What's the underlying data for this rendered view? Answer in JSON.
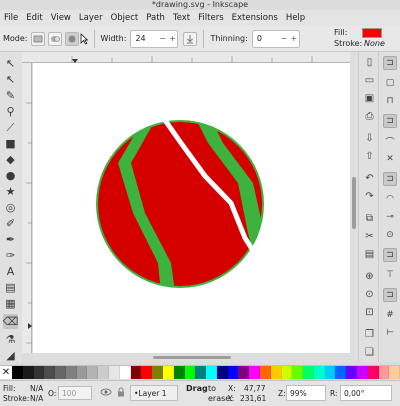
{
  "window": {
    "title": "*drawing.svg - Inkscape"
  },
  "menu": [
    "File",
    "Edit",
    "View",
    "Layer",
    "Object",
    "Path",
    "Text",
    "Filters",
    "Extensions",
    "Help"
  ],
  "toolctrl": {
    "mode_label": "Mode:",
    "width_label": "Width:",
    "width_value": "24",
    "thinning_label": "Thinning:",
    "thinning_value": "0",
    "minus": "−",
    "plus": "+"
  },
  "style": {
    "fill_label": "Fill:",
    "fill_color": "#ff0000",
    "stroke_label": "Stroke:",
    "stroke_value": "None"
  },
  "drawing": {
    "fill": "#d40000",
    "stroke": "#3db33d"
  },
  "palette": [
    "#000000",
    "#1a1a1a",
    "#333333",
    "#4d4d4d",
    "#666666",
    "#808080",
    "#999999",
    "#b3b3b3",
    "#cccccc",
    "#e6e6e6",
    "#ffffff",
    "#800000",
    "#ff0000",
    "#808000",
    "#ffff00",
    "#008000",
    "#00ff00",
    "#008080",
    "#00ffff",
    "#000080",
    "#0000ff",
    "#800080",
    "#ff00ff",
    "#ff6600",
    "#ffcc00",
    "#ccff00",
    "#66ff00",
    "#00ff66",
    "#00ffcc",
    "#00ccff",
    "#0066ff",
    "#6600ff",
    "#cc00ff",
    "#ff0066",
    "#ff9999",
    "#ffcc99"
  ],
  "status": {
    "fill_label": "Fill:",
    "fill_value": "N/A",
    "stroke_label": "Stroke:",
    "stroke_value": "N/A",
    "opacity_label": "O:",
    "opacity_value": "100",
    "layer": "•Layer 1",
    "message_bold": "Drag",
    "message_rest": "to erase.",
    "x_label": "X:",
    "x_value": "47,77",
    "y_label": "Y:",
    "y_value": "231,61",
    "zoom_label": "Z:",
    "zoom_value": "99%",
    "rotation_label": "R:",
    "rotation_value": "0,00°"
  },
  "icons": {
    "tools": [
      "selector-icon",
      "node-icon",
      "tweak-icon",
      "zoom-icon",
      "measure-icon",
      "rect-icon",
      "3dbox-icon",
      "ellipse-icon",
      "star-icon",
      "spiral-icon",
      "pencil-icon",
      "pen-icon",
      "calligraphy-icon",
      "text-icon",
      "gradient-icon",
      "mesh-icon",
      "dropper-icon",
      "paintbucket-icon",
      "eraser-icon",
      "spray-icon"
    ]
  }
}
